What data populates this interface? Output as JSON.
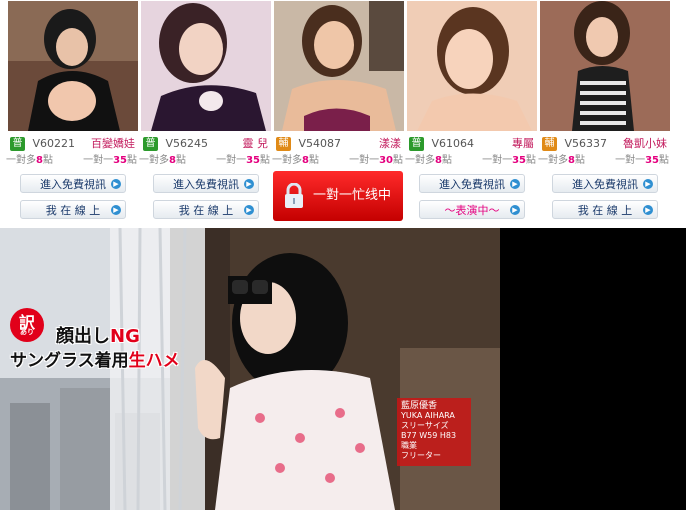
{
  "cards": [
    {
      "level": "普",
      "level_color": "#2c9a2c",
      "id": "V60221",
      "name": "百變嬌娃",
      "price_a_prefix": "一對多",
      "price_a": "8",
      "price_b_prefix": "一對一",
      "price_b": "35",
      "unit": "點",
      "btn1": "進入免費視訊",
      "btn2": "我 在 線 上",
      "btn2_style": "online"
    },
    {
      "level": "普",
      "level_color": "#2c9a2c",
      "id": "V56245",
      "name": "靈 兒",
      "price_a_prefix": "一對多",
      "price_a": "8",
      "price_b_prefix": "一對一",
      "price_b": "35",
      "unit": "點",
      "btn1": "進入免費視訊",
      "btn2": "我 在 線 上",
      "btn2_style": "online"
    },
    {
      "level": "輔",
      "level_color": "#e08a17",
      "id": "V54087",
      "name": "漾漾",
      "price_a_prefix": "一對多",
      "price_a": "8",
      "price_b_prefix": "一對一",
      "price_b": "30",
      "unit": "點",
      "busy_label": "一對一忙线中",
      "busy_icon": "lock-icon"
    },
    {
      "level": "普",
      "level_color": "#2c9a2c",
      "id": "V61064",
      "name": "專屬",
      "price_a_prefix": "一對多",
      "price_a": "8",
      "price_b_prefix": "一對一",
      "price_b": "35",
      "unit": "點",
      "btn1": "進入免費視訊",
      "btn2": "～表演中～",
      "btn2_style": "live"
    },
    {
      "level": "輔",
      "level_color": "#e08a17",
      "id": "V56337",
      "name": "魯凱小妹",
      "price_a_prefix": "一對多",
      "price_a": "8",
      "price_b_prefix": "一對一",
      "price_b": "35",
      "unit": "點",
      "btn1": "進入免費視訊",
      "btn2": "我 在 線 上",
      "btn2_style": "online"
    }
  ],
  "banner": {
    "badge_main": "訳",
    "badge_sub": "あり",
    "caption_line1_a": "顔出し",
    "caption_line1_b": "NG",
    "caption_line2_a": "サングラス着用",
    "caption_line2_b": "生ハメ",
    "profile": {
      "name_jp": "藍原優香",
      "name_en": "YUKA AIHARA",
      "size_label": "スリーサイズ",
      "size_value": "B77 W59 H83",
      "job_label": "職業",
      "job_value": "フリーター"
    }
  }
}
